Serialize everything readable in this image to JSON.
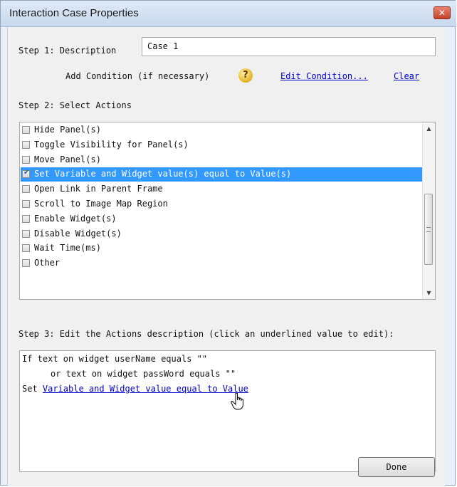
{
  "window": {
    "title": "Interaction Case Properties",
    "close_glyph": "✕"
  },
  "step1": {
    "label": "Step 1: Description",
    "description_value": "Case 1",
    "add_condition_label": "Add Condition (if necessary)",
    "help_icon": "question-bubble-icon",
    "edit_condition_link": "Edit Condition...",
    "clear_link": "Clear"
  },
  "step2": {
    "label": "Step 2: Select Actions",
    "actions": [
      {
        "label": "Hide Panel(s)",
        "checked": false,
        "selected": false
      },
      {
        "label": "Toggle Visibility for Panel(s)",
        "checked": false,
        "selected": false
      },
      {
        "label": "Move Panel(s)",
        "checked": false,
        "selected": false
      },
      {
        "label": "Set Variable and Widget value(s) equal to Value(s)",
        "checked": true,
        "selected": true
      },
      {
        "label": "Open Link in Parent Frame",
        "checked": false,
        "selected": false
      },
      {
        "label": "Scroll to Image Map Region",
        "checked": false,
        "selected": false
      },
      {
        "label": "Enable Widget(s)",
        "checked": false,
        "selected": false
      },
      {
        "label": "Disable Widget(s)",
        "checked": false,
        "selected": false
      },
      {
        "label": "Wait Time(ms)",
        "checked": false,
        "selected": false
      },
      {
        "label": "Other",
        "checked": false,
        "selected": false
      }
    ],
    "check_glyph": "✔"
  },
  "step3": {
    "label": "Step 3: Edit the Actions description (click an underlined value to edit):",
    "line1": "If text on widget userName equals \"\"",
    "line2": "or text on widget passWord equals \"\"",
    "line3_prefix": "Set ",
    "line3_link": "Variable and Widget value equal to Value"
  },
  "footer": {
    "done_label": "Done"
  },
  "colors": {
    "selection": "#3399ff",
    "link": "#0000cc",
    "close_button": "#c5422a"
  }
}
